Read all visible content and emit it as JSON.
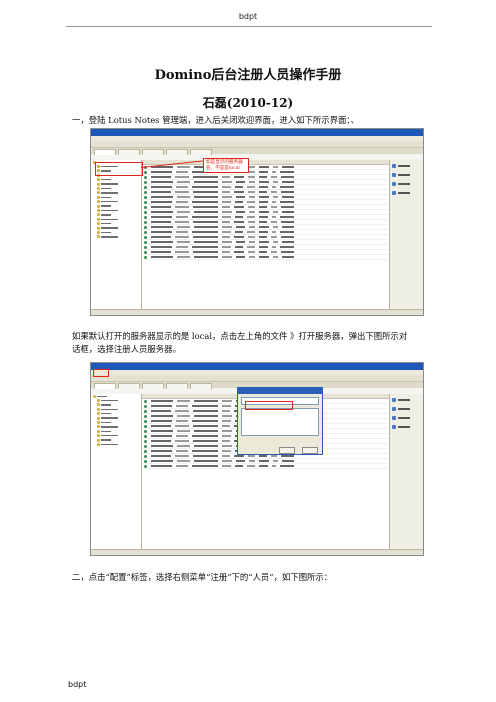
{
  "page_header": "bdpt",
  "page_footer": "bdpt",
  "title": "Domino后台注册人员操作手册",
  "subtitle": "石磊(2010-12)",
  "para1": "一，登陆 Lotus Notes 管理端，进入后关闭欢迎界面，进入如下所示界面：、",
  "para2_line1": "如果默认打开的服务器显示的是 local，点击左上角的文件 》打开服务器，弹出下图所示对",
  "para2_line2": "话框，选择注册人员服务器。",
  "para3": "二，点击“配置”标签，选择右侧菜单“注册”下的“人员”，如下图所示：",
  "screenshot1": {
    "callout_text": "如是显示的服务器名，不是是local",
    "side_buttons": [
      "注册人员",
      "文件夹",
      "数据库",
      "用户"
    ]
  },
  "screenshot2": {
    "side_buttons": [
      "注册人员",
      "文件夹",
      "数据库",
      "用户"
    ]
  }
}
